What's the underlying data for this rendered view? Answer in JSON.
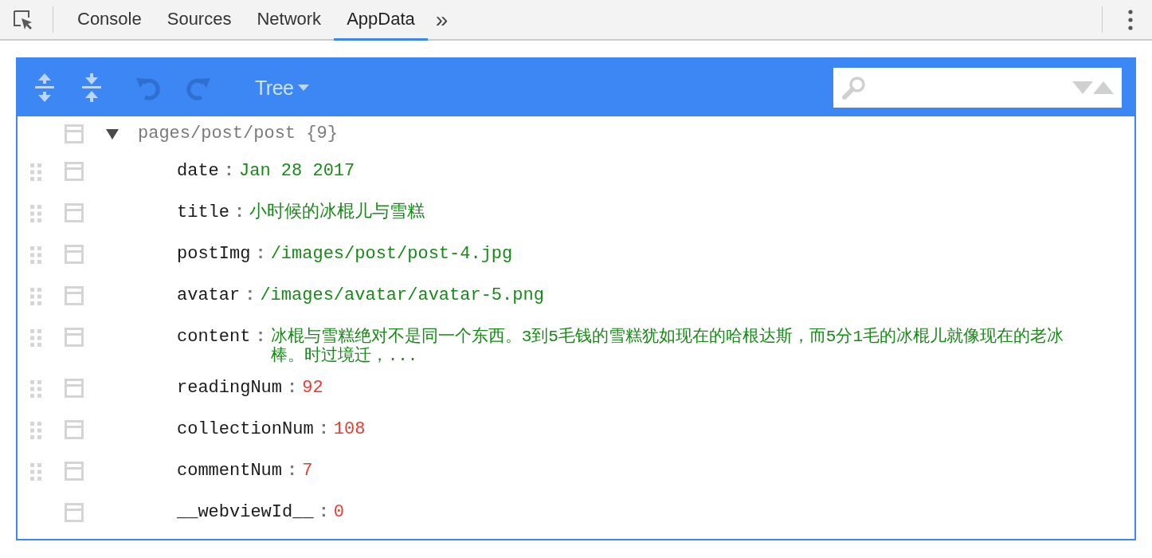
{
  "tabs": [
    {
      "label": "Console",
      "selected": false
    },
    {
      "label": "Sources",
      "selected": false
    },
    {
      "label": "Network",
      "selected": false
    },
    {
      "label": "AppData",
      "selected": true
    }
  ],
  "more_tabs": "»",
  "toolbar": {
    "undo_disabled": true,
    "redo_disabled": true,
    "mode": "Tree"
  },
  "tree": {
    "root": {
      "label": "pages/post/post {9}",
      "expanded": true,
      "draggable": false
    },
    "children": [
      {
        "key": "date",
        "separator": ":",
        "value": "Jan 28 2017",
        "kind": "string",
        "draggable": true
      },
      {
        "key": "title",
        "separator": ":",
        "value": "小时候的冰棍儿与雪糕",
        "kind": "string",
        "draggable": true
      },
      {
        "key": "postImg",
        "separator": ":",
        "value": "/images/post/post-4.jpg",
        "kind": "string",
        "draggable": true
      },
      {
        "key": "avatar",
        "separator": ":",
        "value": "/images/avatar/avatar-5.png",
        "kind": "string",
        "draggable": true
      },
      {
        "key": "content",
        "separator": ":",
        "value": "冰棍与雪糕绝对不是同一个东西。3到5毛钱的雪糕犹如现在的哈根达斯，而5分1毛的冰棍儿就像现在的老冰棒。时过境迁，...",
        "kind": "string",
        "draggable": true
      },
      {
        "key": "readingNum",
        "separator": ":",
        "value": "92",
        "kind": "number",
        "draggable": true
      },
      {
        "key": "collectionNum",
        "separator": ":",
        "value": "108",
        "kind": "number",
        "draggable": true
      },
      {
        "key": "commentNum",
        "separator": ":",
        "value": "7",
        "kind": "number",
        "draggable": true
      },
      {
        "key": "__webviewId__",
        "separator": ":",
        "value": "0",
        "kind": "number",
        "draggable": false
      }
    ]
  }
}
